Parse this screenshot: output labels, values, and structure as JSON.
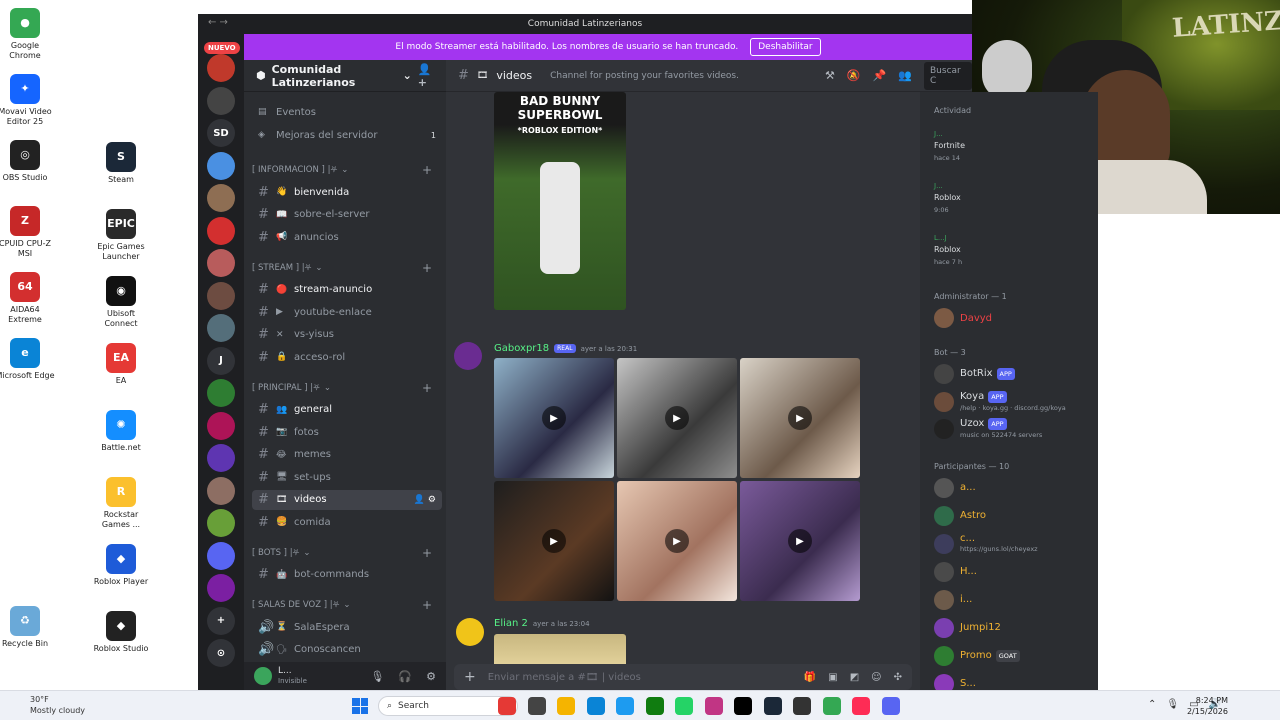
{
  "desktop": {
    "icons_col1": [
      {
        "label": "Google Chrome",
        "color": "#34a853",
        "glyph": "●"
      },
      {
        "label": "Movavi Video Editor 25",
        "color": "#1565ff",
        "glyph": "✦"
      },
      {
        "label": "OBS Studio",
        "color": "#222222",
        "glyph": "◎"
      },
      {
        "label": "CPUID CPU-Z MSI",
        "color": "#c62828",
        "glyph": "Z"
      },
      {
        "label": "AIDA64 Extreme",
        "color": "#d32f2f",
        "glyph": "64"
      },
      {
        "label": "Microsoft Edge",
        "color": "#0a84d6",
        "glyph": "e"
      },
      {
        "label": "Recycle Bin",
        "color": "#6aa9d8",
        "glyph": "♻"
      }
    ],
    "icons_col2": [
      {
        "label": "Steam",
        "color": "#1b2838",
        "glyph": "S"
      },
      {
        "label": "Epic Games Launcher",
        "color": "#2a2a2a",
        "glyph": "EPIC"
      },
      {
        "label": "Ubisoft Connect",
        "color": "#111111",
        "glyph": "◉"
      },
      {
        "label": "EA",
        "color": "#e53935",
        "glyph": "EA"
      },
      {
        "label": "Battle.net",
        "color": "#148eff",
        "glyph": "✺"
      },
      {
        "label": "Rockstar Games ...",
        "color": "#fbc02d",
        "glyph": "R"
      },
      {
        "label": "Roblox Player",
        "color": "#1e5bd8",
        "glyph": "◆"
      },
      {
        "label": "Roblox Studio",
        "color": "#222222",
        "glyph": "◆"
      }
    ]
  },
  "discord": {
    "window_title": "Comunidad Latinzerianos",
    "nuevo_badge": "NUEVO",
    "streamer_banner": "El modo Streamer está habilitado. Los nombres de usuario se han truncado.",
    "streamer_button": "Deshabilitar",
    "server_name": "Comunidad Latinzerianos",
    "servers": [
      {
        "label": "",
        "color": "#c0392b",
        "badge": ""
      },
      {
        "label": "",
        "color": "#444444",
        "badge": ""
      },
      {
        "label": "SD",
        "color": "#313338",
        "badge": ""
      },
      {
        "label": "",
        "color": "#4a90e2",
        "badge": ""
      },
      {
        "label": "",
        "color": "#8e6e53",
        "badge": "2"
      },
      {
        "label": "",
        "color": "#d32f2f",
        "badge": "240"
      },
      {
        "label": "",
        "color": "#b85c5c",
        "badge": "126"
      },
      {
        "label": "",
        "color": "#6d4c41",
        "badge": "577"
      },
      {
        "label": "",
        "color": "#546e7a",
        "badge": "6"
      },
      {
        "label": "J",
        "color": "#313338",
        "badge": ""
      },
      {
        "label": "",
        "color": "#2e7d32",
        "badge": ""
      },
      {
        "label": "",
        "color": "#ad1457",
        "badge": "336"
      },
      {
        "label": "",
        "color": "#5e35b1",
        "badge": "56"
      },
      {
        "label": "",
        "color": "#8d6e63",
        "badge": "672"
      },
      {
        "label": "",
        "color": "#689f38",
        "badge": "6"
      },
      {
        "label": "",
        "color": "#5865f2",
        "badge": ""
      },
      {
        "label": "",
        "color": "#7b1fa2",
        "badge": ""
      },
      {
        "label": "+",
        "color": "#313338",
        "badge": ""
      },
      {
        "label": "⊙",
        "color": "#313338",
        "badge": ""
      }
    ],
    "top_items": [
      {
        "label": "Eventos",
        "icon": "▤",
        "count": ""
      },
      {
        "label": "Mejoras del servidor",
        "icon": "◈",
        "count": "1"
      }
    ],
    "categories": [
      {
        "name": "[ INFORMACION ] |⛧",
        "channels": [
          {
            "name": "bienvenida",
            "emoji": "👋",
            "unread": true
          },
          {
            "name": "sobre-el-server",
            "emoji": "📖",
            "unread": false
          },
          {
            "name": "anuncios",
            "emoji": "📢",
            "unread": false
          }
        ]
      },
      {
        "name": "[ STREAM ] |⛧",
        "channels": [
          {
            "name": "stream-anuncio",
            "emoji": "🔴",
            "unread": true
          },
          {
            "name": "youtube-enlace",
            "emoji": "▶",
            "unread": false
          },
          {
            "name": "vs-yisus",
            "emoji": "✕",
            "unread": false
          },
          {
            "name": "acceso-rol",
            "emoji": "🔒",
            "unread": false
          }
        ]
      },
      {
        "name": "[ PRINCIPAL ] |⛧",
        "channels": [
          {
            "name": "general",
            "emoji": "👥",
            "unread": true
          },
          {
            "name": "fotos",
            "emoji": "📷",
            "unread": false
          },
          {
            "name": "memes",
            "emoji": "😂",
            "unread": false
          },
          {
            "name": "set-ups",
            "emoji": "🖥",
            "unread": false
          },
          {
            "name": "videos",
            "emoji": "🎞",
            "unread": false,
            "active": true
          },
          {
            "name": "comida",
            "emoji": "🍔",
            "unread": false
          }
        ]
      },
      {
        "name": "[ BOTS ] |⛧",
        "channels": [
          {
            "name": "bot-commands",
            "emoji": "🤖",
            "unread": false
          }
        ]
      },
      {
        "name": "[ SALAS DE VOZ ] |⛧",
        "channels": [
          {
            "name": "SalaEspera",
            "emoji": "⏳",
            "unread": false,
            "voice": true
          },
          {
            "name": "Conoscancen",
            "emoji": "🗣",
            "unread": false,
            "voice": true
          }
        ]
      }
    ],
    "user": {
      "name": "L...",
      "status": "Invisible"
    },
    "channel": {
      "name": "videos",
      "topic": "Channel for posting your favorites videos.",
      "search_placeholder": "Buscar C"
    },
    "messages": [
      {
        "author": "Gaboxpr18",
        "tag": "REAL",
        "time": "ayer a las 20:31",
        "reactions": [
          "❤",
          "😂",
          "😮"
        ]
      },
      {
        "author": "Elian 2",
        "time": "ayer a las 23:04"
      }
    ],
    "first_video_title": "BAD BUNNY SUPERBOWL",
    "first_video_sub": "*ROBLOX EDITION*",
    "composer_placeholder": "Enviar mensaje a #🎞 | videos"
  },
  "members": {
    "activity_header": "Actividad",
    "activities": [
      {
        "user": "J...",
        "game": "Fortnite",
        "when": "hace 14"
      },
      {
        "user": "J...",
        "game": "Roblox",
        "when": "9:06"
      },
      {
        "user": "L...J",
        "game": "Roblox",
        "when": "hace 7 h"
      }
    ],
    "admin_header": "Administrator — 1",
    "admins": [
      {
        "name": "Davyd",
        "color": "#ed4245"
      }
    ],
    "bot_header": "Bot — 3",
    "bots": [
      {
        "name": "BotRix",
        "badge": "APP",
        "sub": ""
      },
      {
        "name": "Koya",
        "badge": "APP",
        "sub": "/help · koya.gg · discord.gg/koya"
      },
      {
        "name": "Uzox",
        "badge": "APP",
        "sub": "music on 522474 servers"
      }
    ],
    "participants_header": "Participantes — 10",
    "participants": [
      {
        "name": "a...",
        "color": "#f0b232",
        "sub": "",
        "badge": ""
      },
      {
        "name": "Astro",
        "color": "#f0b232",
        "sub": "",
        "badge": ""
      },
      {
        "name": "c...",
        "color": "#f0b232",
        "sub": "https://guns.lol/cheyexz",
        "badge": ""
      },
      {
        "name": "H...",
        "color": "#f0b232",
        "sub": "",
        "badge": ""
      },
      {
        "name": "i...",
        "color": "#f0b232",
        "sub": "",
        "badge": ""
      },
      {
        "name": "Jumpi12",
        "color": "#f0b232",
        "sub": "",
        "badge": ""
      },
      {
        "name": "Promo",
        "color": "#f0b232",
        "sub": "",
        "badge": "GOAT"
      },
      {
        "name": "S...",
        "color": "#f0b232",
        "sub": "",
        "badge": ""
      }
    ]
  },
  "taskbar": {
    "temp": "30°F",
    "weather": "Mostly cloudy",
    "search": "Search",
    "time": "8:24 PM",
    "date": "2/15/2026"
  }
}
